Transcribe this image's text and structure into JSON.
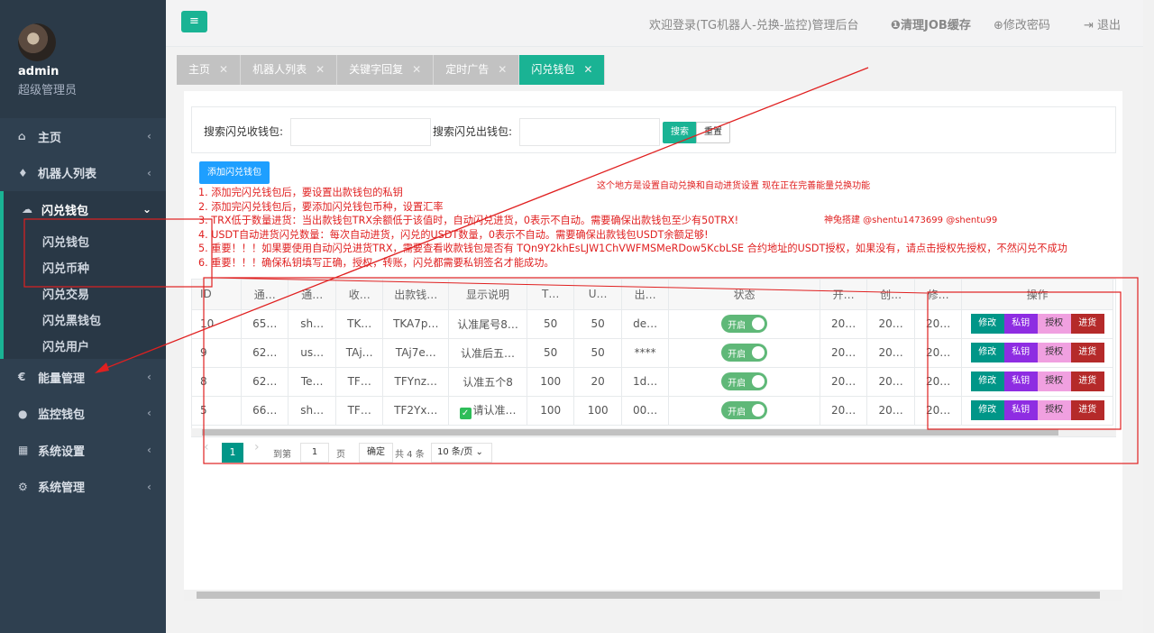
{
  "user": {
    "name": "admin",
    "role": "超级管理员"
  },
  "sidebar": {
    "items": [
      {
        "icon": "⌂",
        "label": "主页",
        "arrow": "‹"
      },
      {
        "icon": "♦",
        "label": "机器人列表",
        "arrow": "‹"
      },
      {
        "icon": "☁",
        "label": "闪兑钱包",
        "arrow": "⌄"
      },
      {
        "icon": "€",
        "label": "能量管理",
        "arrow": "‹"
      },
      {
        "icon": "●",
        "label": "监控钱包",
        "arrow": "‹"
      },
      {
        "icon": "▦",
        "label": "系统设置",
        "arrow": "‹"
      },
      {
        "icon": "⚙",
        "label": "系统管理",
        "arrow": "‹"
      }
    ],
    "submenu": [
      "闪兑钱包",
      "闪兑币种",
      "闪兑交易",
      "闪兑黑钱包",
      "闪兑用户"
    ]
  },
  "header": {
    "menu_icon": "≡",
    "title": "欢迎登录(TG机器人-兑换-监控)管理后台",
    "clear_job": "清理JOB缓存",
    "change_pwd": "修改密码",
    "logout": "退出"
  },
  "tabs": [
    {
      "label": "主页"
    },
    {
      "label": "机器人列表"
    },
    {
      "label": "关键字回复"
    },
    {
      "label": "定时广告"
    },
    {
      "label": "闪兑钱包"
    }
  ],
  "search": {
    "in_label": "搜索闪兑收钱包:",
    "out_label": "搜索闪兑出钱包:",
    "search_btn": "搜索",
    "reset_btn": "重置"
  },
  "add_button": "添加闪兑钱包",
  "notes": [
    "1. 添加完闪兑钱包后，要设置出款钱包的私钥",
    "2. 添加完闪兑钱包后，要添加闪兑钱包币种，设置汇率",
    "3. TRX低于数量进货：当出款钱包TRX余额低于该值时，自动闪兑进货，0表示不自动。需要确保出款钱包至少有50TRX!",
    "4. USDT自动进货闪兑数量：每次自动进货，闪兑的USDT数量，0表示不自动。需要确保出款钱包USDT余额足够!",
    "5. 重要！！！如果要使用自动闪兑进货TRX，需要查看收款钱包是否有 TQn9Y2khEsLJW1ChVWFMSMeRDow5KcbLSE 合约地址的USDT授权，如果没有，请点击授权先授权，不然闪兑不成功",
    "6. 重要！！！确保私钥填写正确，授权，转账，闪兑都需要私钥签名才能成功。"
  ],
  "annotations": {
    "a1": "这个地方是设置自动兑换和自动进货设置  现在正在完善能量兑换功能",
    "a2": "神兔搭建 @shentu1473699 @shentu99"
  },
  "table": {
    "headers": [
      "ID",
      "通…",
      "通…",
      "收…",
      "出款钱…",
      "显示说明",
      "T…",
      "U…",
      "出…",
      "状态",
      "开…",
      "创…",
      "修…",
      "操作"
    ],
    "rows": [
      [
        "10",
        "65…",
        "sh…",
        "TK…",
        "TKA7p…",
        "认准尾号8…",
        "50",
        "50",
        "de…",
        "开启",
        "20…",
        "20…",
        "20…"
      ],
      [
        "9",
        "62…",
        "us…",
        "TAj…",
        "TAj7e…",
        "认准后五…",
        "50",
        "50",
        "****",
        "开启",
        "20…",
        "20…",
        "20…"
      ],
      [
        "8",
        "62…",
        "Te…",
        "TF…",
        "TFYnz…",
        "认准五个8",
        "100",
        "20",
        "1d…",
        "开启",
        "20…",
        "20…",
        "20…"
      ],
      [
        "5",
        "66…",
        "sh…",
        "TF…",
        "TF2Yx…",
        "请认准…",
        "100",
        "100",
        "00…",
        "开启",
        "20…",
        "20…",
        "20…"
      ]
    ],
    "ops": [
      "修改",
      "私钥",
      "授权",
      "进货"
    ]
  },
  "pager": {
    "prev": "‹",
    "current": "1",
    "next": "›",
    "goto": "到第",
    "goto_value": "1",
    "page_unit": "页",
    "confirm": "确定",
    "total": "共 4 条",
    "page_size": "10 条/页"
  }
}
